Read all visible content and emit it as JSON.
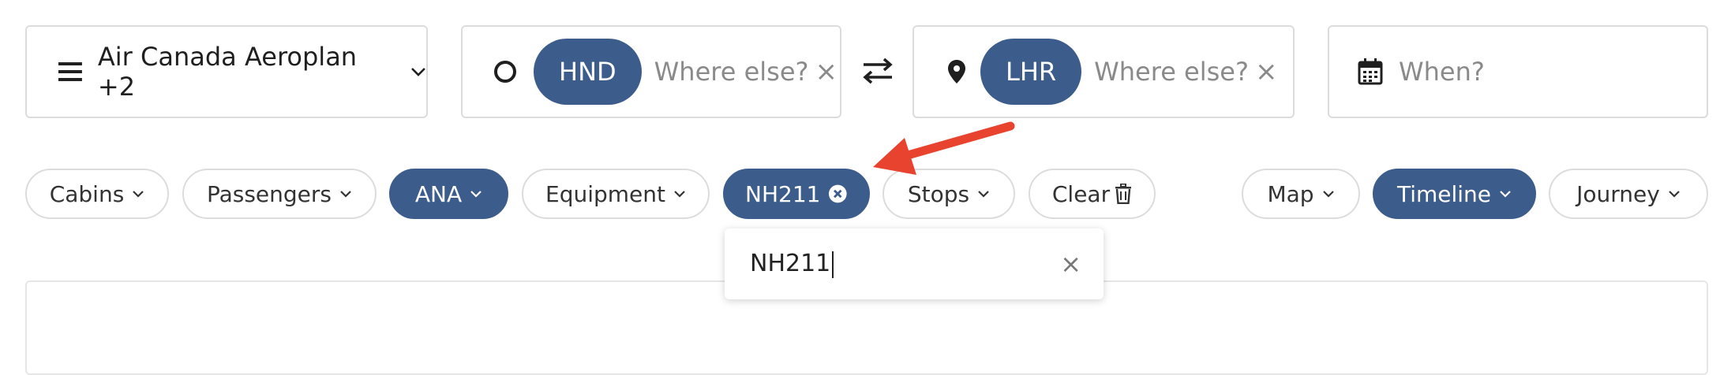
{
  "program_selector": {
    "label": "Air Canada Aeroplan +2",
    "icon": "menu-icon"
  },
  "origin": {
    "chip": "HND",
    "placeholder": "Where else?",
    "icon": "circle-icon"
  },
  "destination": {
    "chip": "LHR",
    "placeholder": "Where else?",
    "icon": "location-pin-icon"
  },
  "when": {
    "placeholder": "When?",
    "icon": "calendar-icon"
  },
  "filters": {
    "cabins": "Cabins",
    "passengers": "Passengers",
    "airline": "ANA",
    "equipment": "Equipment",
    "flight": "NH211",
    "stops": "Stops",
    "clear": "Clear"
  },
  "views": {
    "map": "Map",
    "timeline": "Timeline",
    "journey": "Journey"
  },
  "flight_filter_dropdown": {
    "value": "NH211"
  },
  "colors": {
    "accent": "#3c5d8c",
    "annotation_arrow": "#e8432f",
    "border": "#dcdcdc"
  }
}
